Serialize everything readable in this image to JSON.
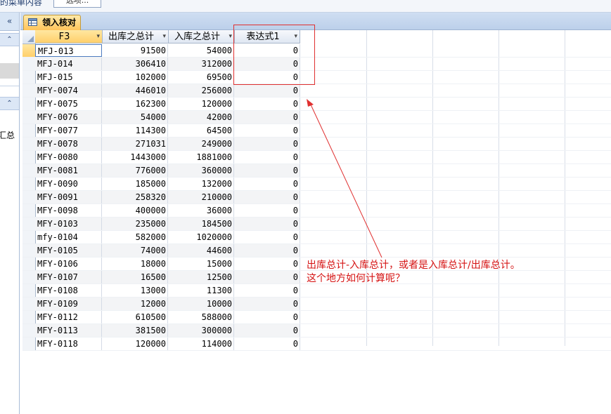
{
  "topbar": {
    "crumb_text": "的菜单内容",
    "button_label": "选项..."
  },
  "nav": {
    "collapse_glyph": "«",
    "section_glyph": "⌃",
    "visible_text": "汇总"
  },
  "tab": {
    "label": "领入核对"
  },
  "table": {
    "columns": [
      {
        "label": "F3"
      },
      {
        "label": "出库之总计"
      },
      {
        "label": "入库之总计"
      },
      {
        "label": "表达式1"
      }
    ],
    "dropdown_glyph": "▾",
    "rows": [
      {
        "id": "MFJ-013",
        "out": "91500",
        "in": "54000",
        "expr": "0"
      },
      {
        "id": "MFJ-014",
        "out": "306410",
        "in": "312000",
        "expr": "0"
      },
      {
        "id": "MFJ-015",
        "out": "102000",
        "in": "69500",
        "expr": "0"
      },
      {
        "id": "MFY-0074",
        "out": "446010",
        "in": "256000",
        "expr": "0"
      },
      {
        "id": "MFY-0075",
        "out": "162300",
        "in": "120000",
        "expr": "0"
      },
      {
        "id": "MFY-0076",
        "out": "54000",
        "in": "42000",
        "expr": "0"
      },
      {
        "id": "MFY-0077",
        "out": "114300",
        "in": "64500",
        "expr": "0"
      },
      {
        "id": "MFY-0078",
        "out": "271031",
        "in": "249000",
        "expr": "0"
      },
      {
        "id": "MFY-0080",
        "out": "1443000",
        "in": "1881000",
        "expr": "0"
      },
      {
        "id": "MFY-0081",
        "out": "776000",
        "in": "360000",
        "expr": "0"
      },
      {
        "id": "MFY-0090",
        "out": "185000",
        "in": "132000",
        "expr": "0"
      },
      {
        "id": "MFY-0091",
        "out": "258320",
        "in": "210000",
        "expr": "0"
      },
      {
        "id": "MFY-0098",
        "out": "400000",
        "in": "36000",
        "expr": "0"
      },
      {
        "id": "MFY-0103",
        "out": "235000",
        "in": "184500",
        "expr": "0"
      },
      {
        "id": "mfy-0104",
        "out": "582000",
        "in": "1020000",
        "expr": "0"
      },
      {
        "id": "MFY-0105",
        "out": "74000",
        "in": "44600",
        "expr": "0"
      },
      {
        "id": "MFY-0106",
        "out": "18000",
        "in": "15000",
        "expr": "0"
      },
      {
        "id": "MFY-0107",
        "out": "16500",
        "in": "12500",
        "expr": "0"
      },
      {
        "id": "MFY-0108",
        "out": "13000",
        "in": "11300",
        "expr": "0"
      },
      {
        "id": "MFY-0109",
        "out": "12000",
        "in": "10000",
        "expr": "0"
      },
      {
        "id": "MFY-0112",
        "out": "610500",
        "in": "588000",
        "expr": "0"
      },
      {
        "id": "MFY-0113",
        "out": "381500",
        "in": "300000",
        "expr": "0"
      },
      {
        "id": "MFY-0118",
        "out": "120000",
        "in": "114000",
        "expr": "0"
      }
    ]
  },
  "annotation": {
    "line1": "出库总计-入库总计，或者是入库总计/出库总计。",
    "line2": "这个地方如何计算呢？",
    "color": "#d51212"
  }
}
